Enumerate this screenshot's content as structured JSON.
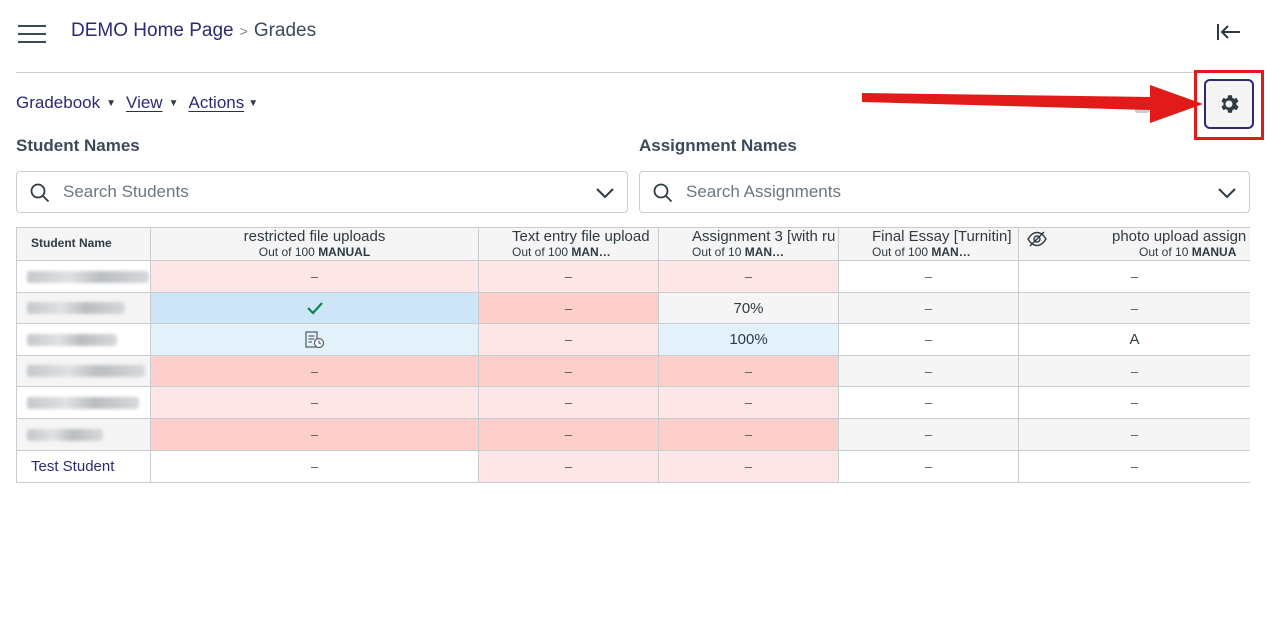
{
  "breadcrumb": {
    "course": "DEMO Home Page",
    "separator": ">",
    "current": "Grades"
  },
  "menus": {
    "gradebook": "Gradebook",
    "view": "View",
    "actions": "Actions",
    "caret": "▼"
  },
  "filters": {
    "student_label": "Student Names",
    "student_placeholder": "Search Students",
    "assignment_label": "Assignment Names",
    "assignment_placeholder": "Search Assignments"
  },
  "grid": {
    "student_header": "Student Name",
    "columns": [
      {
        "title": "restricted file uploads",
        "out_of": "Out of 100",
        "tag": "MANUAL",
        "hidden_icon": false
      },
      {
        "title": "Text entry file upload",
        "out_of": "Out of 100",
        "tag": "MAN…",
        "hidden_icon": false
      },
      {
        "title": "Assignment 3 [with ru",
        "out_of": "Out of 10",
        "tag": "MAN…",
        "hidden_icon": false
      },
      {
        "title": "Final Essay [Turnitin]",
        "out_of": "Out of 100",
        "tag": "MAN…",
        "hidden_icon": false
      },
      {
        "title": "photo upload assign",
        "out_of": "Out of 10",
        "tag": "MANUA",
        "hidden_icon": true
      }
    ],
    "rows": [
      {
        "student": "",
        "blurred": true,
        "cells": [
          "–",
          "–",
          "–",
          "–",
          "–"
        ]
      },
      {
        "student": "",
        "blurred": true,
        "cells": [
          "check-icon",
          "–",
          "70%",
          "–",
          "–"
        ]
      },
      {
        "student": "",
        "blurred": true,
        "cells": [
          "document-clock-icon",
          "–",
          "100%",
          "–",
          "A"
        ]
      },
      {
        "student": "",
        "blurred": true,
        "cells": [
          "–",
          "–",
          "–",
          "–",
          "–"
        ]
      },
      {
        "student": "",
        "blurred": true,
        "cells": [
          "–",
          "–",
          "–",
          "–",
          "–"
        ]
      },
      {
        "student": "",
        "blurred": true,
        "cells": [
          "–",
          "–",
          "–",
          "–",
          "–"
        ]
      },
      {
        "student": "Test Student",
        "blurred": false,
        "cells": [
          "–",
          "–",
          "–",
          "–",
          "–"
        ]
      }
    ]
  },
  "colors": {
    "brand": "#2d2a72",
    "light_red": "#fde6e5",
    "red": "#fdcfcb",
    "light_blue": "#e3f1fb",
    "blue": "#cde5f7",
    "gray_row": "#f5f5f5",
    "annotation_red": "#e11a1a",
    "check_green": "#0b874b"
  }
}
